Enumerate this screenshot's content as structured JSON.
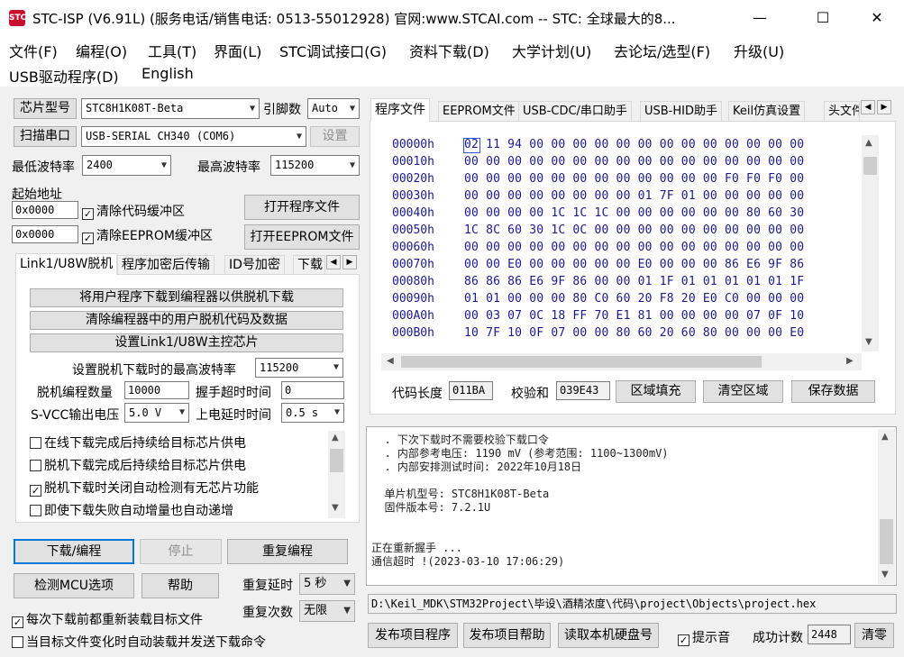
{
  "window": {
    "title": "STC-ISP (V6.91L) (服务电话/销售电话: 0513-55012928) 官网:www.STCAI.com  -- STC: 全球最大的8...",
    "app_icon_text": "STC",
    "minimize": "—",
    "maximize": "☐",
    "close": "✕"
  },
  "menu": [
    "文件(F)",
    "编程(O)",
    "工具(T)",
    "界面(L)",
    "STC调试接口(G)",
    "资料下载(D)",
    "大学计划(U)",
    "去论坛/选型(F)",
    "升级(U)",
    "USB驱动程序(D)",
    "English"
  ],
  "left": {
    "chip_button": "芯片型号",
    "chip_value": "STC8H1K08T-Beta",
    "pins_label": "引脚数",
    "pins_value": "Auto",
    "scan_button": "扫描串口",
    "port_value": "USB-SERIAL CH340 (COM6)",
    "settings_button": "设置",
    "min_baud_label": "最低波特率",
    "min_baud_value": "2400",
    "max_baud_label": "最高波特率",
    "max_baud_value": "115200",
    "start_addr_label": "起始地址",
    "addr1": "0x0000",
    "clear_code_label": "清除代码缓冲区",
    "open_program_button": "打开程序文件",
    "addr2": "0x0000",
    "clear_eeprom_label": "清除EEPROM缓冲区",
    "open_eeprom_button": "打开EEPROM文件",
    "tabs": [
      "Link1/U8W脱机",
      "程序加密后传输",
      "ID号加密",
      "下载"
    ],
    "offline": {
      "btn_download": "将用户程序下载到编程器以供脱机下载",
      "btn_clear": "清除编程器中的用户脱机代码及数据",
      "btn_set_chip": "设置Link1/U8W主控芯片",
      "max_baud_label": "设置脱机下载时的最高波特率",
      "max_baud_value": "115200",
      "count_label": "脱机编程数量",
      "count_value": "10000",
      "handshake_label": "握手超时时间",
      "handshake_value": "0",
      "svcc_label": "S-VCC输出电压",
      "svcc_value": "5.0 V",
      "power_delay_label": "上电延时时间",
      "power_delay_value": "0.5 s",
      "checks": [
        {
          "label": "在线下载完成后持续给目标芯片供电",
          "checked": false
        },
        {
          "label": "脱机下载完成后持续给目标芯片供电",
          "checked": false
        },
        {
          "label": "脱机下载时关闭自动检测有无芯片功能",
          "checked": true
        },
        {
          "label": "即使下载失败自动增量也自动递增",
          "checked": false
        }
      ]
    },
    "btn_download_program": "下载/编程",
    "btn_stop": "停止",
    "btn_repeat": "重复编程",
    "btn_check_mcu": "检测MCU选项",
    "btn_help": "帮助",
    "repeat_delay_label": "重复延时",
    "repeat_delay_value": "5 秒",
    "repeat_count_label": "重复次数",
    "repeat_count_value": "无限",
    "reload_label": "每次下载前都重新装载目标文件",
    "reload_checked": true,
    "auto_send_label": "当目标文件变化时自动装载并发送下载命令",
    "auto_send_checked": false
  },
  "right": {
    "tabs": [
      "程序文件",
      "EEPROM文件",
      "USB-CDC/串口助手",
      "USB-HID助手",
      "Keil仿真设置",
      "头文件"
    ],
    "hex_rows": [
      {
        "addr": "00000h",
        "bytes": "02 11 94 00 00 00 00 00 00 00 00 00 00 00 00 00"
      },
      {
        "addr": "00010h",
        "bytes": "00 00 00 00 00 00 00 00 00 00 00 00 00 00 00 00"
      },
      {
        "addr": "00020h",
        "bytes": "00 00 00 00 00 00 00 00 00 00 00 00 F0 F0 F0 00"
      },
      {
        "addr": "00030h",
        "bytes": "00 00 00 00 00 00 00 00 01 7F 01 00 00 00 00 00"
      },
      {
        "addr": "00040h",
        "bytes": "00 00 00 00 1C 1C 1C 00 00 00 00 00 00 80 60 30"
      },
      {
        "addr": "00050h",
        "bytes": "1C 8C 60 30 1C 0C 00 00 00 00 00 00 00 00 00 00"
      },
      {
        "addr": "00060h",
        "bytes": "00 00 00 00 00 00 00 00 00 00 00 00 00 00 00 00"
      },
      {
        "addr": "00070h",
        "bytes": "00 00 E0 00 00 00 00 00 E0 00 00 00 86 E6 9F 86"
      },
      {
        "addr": "00080h",
        "bytes": "86 86 86 E6 9F 86 00 00 01 1F 01 01 01 01 01 1F"
      },
      {
        "addr": "00090h",
        "bytes": "01 01 00 00 00 80 C0 60 20 F8 20 E0 C0 00 00 00"
      },
      {
        "addr": "000A0h",
        "bytes": "00 03 07 0C 18 FF 70 E1 81 00 00 00 00 07 0F 10"
      },
      {
        "addr": "000B0h",
        "bytes": "10 7F 10 0F 07 00 00 80 60 20 60 80 00 00 00 E0"
      }
    ],
    "code_len_label": "代码长度",
    "code_len_value": "011BA",
    "checksum_label": "校验和",
    "checksum_value": "039E43",
    "btn_fill": "区域填充",
    "btn_clear_area": "清空区域",
    "btn_save": "保存数据",
    "log_lines": [
      "  . 下次下载时不需要校验下载口令",
      "  . 内部参考电压: 1190 mV (参考范围: 1100~1300mV)",
      "  . 内部安排测试时间: 2022年10月18日",
      "",
      "  单片机型号: STC8H1K08T-Beta",
      "  固件版本号: 7.2.1U",
      "",
      "",
      "正在重新握手 ...",
      "通信超时 !(2023-03-10 17:06:29)"
    ],
    "file_path": "D:\\Keil_MDK\\STM32Project\\毕设\\酒精浓度\\代码\\project\\Objects\\project.hex",
    "btn_publish": "发布项目程序",
    "btn_publish_help": "发布项目帮助",
    "btn_read_disk": "读取本机硬盘号",
    "sound_label": "提示音",
    "sound_checked": true,
    "success_label": "成功计数",
    "success_value": "2448",
    "btn_reset": "清零"
  }
}
